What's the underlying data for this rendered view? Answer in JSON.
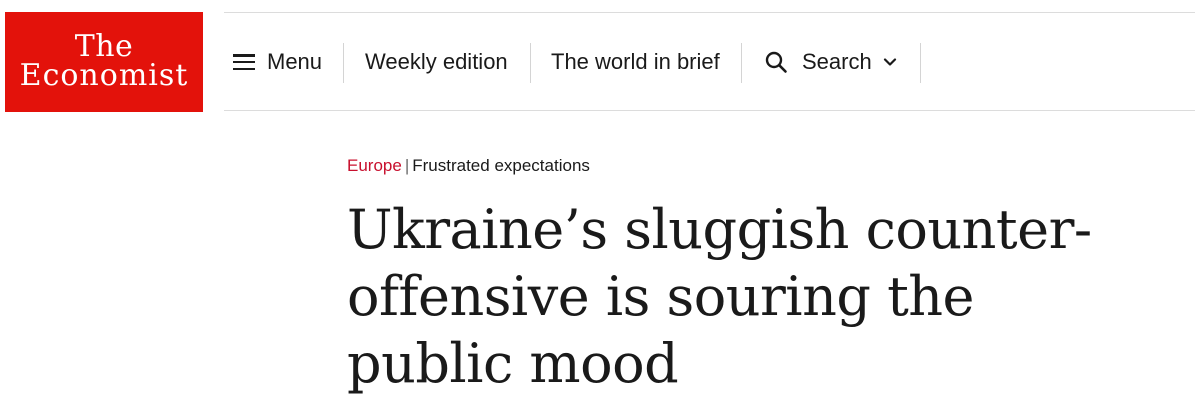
{
  "logo": {
    "line1": "The",
    "line2": "Economist"
  },
  "nav": {
    "menu_label": "Menu",
    "weekly_label": "Weekly edition",
    "brief_label": "The world in brief",
    "search_label": "Search"
  },
  "article": {
    "section": "Europe",
    "separator": "|",
    "fly_title": "Frustrated expectations",
    "headline": "Ukraine’s sluggish counter-offensive is souring the public mood"
  },
  "colors": {
    "brand_red": "#e3120b",
    "section_red": "#c8102e"
  },
  "icons": [
    "menu-icon",
    "search-icon",
    "chevron-down-icon"
  ]
}
